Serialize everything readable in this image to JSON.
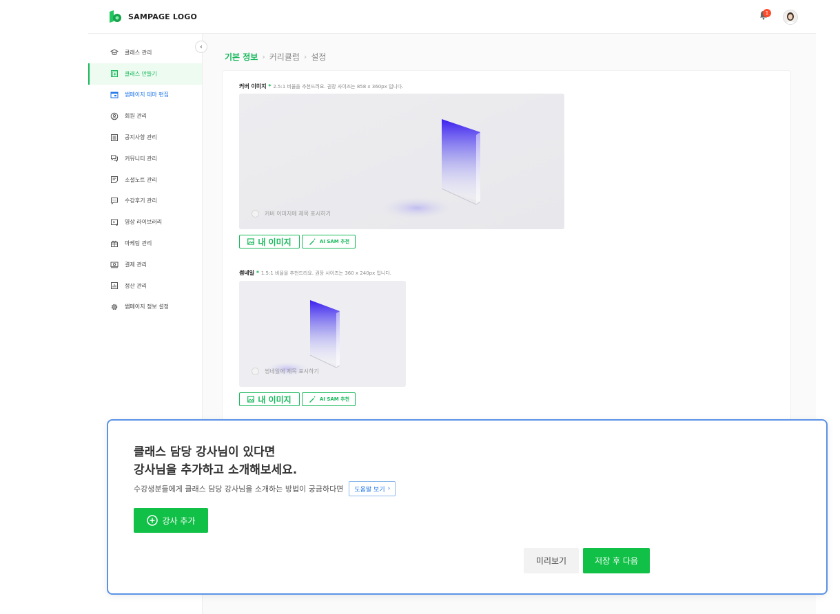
{
  "header": {
    "logo_text": "SAMPAGE LOGO",
    "notification_count": "1"
  },
  "sidebar": {
    "items": [
      {
        "label": "클래스 관리",
        "icon": "graduation-cap-icon"
      },
      {
        "label": "클래스 만들기",
        "icon": "add-box-icon"
      },
      {
        "label": "쌤페이지 테마 편집",
        "icon": "window-theme-icon"
      },
      {
        "label": "회원 관리",
        "icon": "user-circle-icon"
      },
      {
        "label": "공지사항 관리",
        "icon": "notice-list-icon"
      },
      {
        "label": "커뮤니티 관리",
        "icon": "chat-bubbles-icon"
      },
      {
        "label": "소셜노트 관리",
        "icon": "note-icon"
      },
      {
        "label": "수강후기 관리",
        "icon": "comment-icon"
      },
      {
        "label": "영상 라이브러리",
        "icon": "video-library-icon"
      },
      {
        "label": "마케팅 관리",
        "icon": "gift-icon"
      },
      {
        "label": "결제 관리",
        "icon": "payment-icon"
      },
      {
        "label": "정산 관리",
        "icon": "chart-icon"
      },
      {
        "label": "쌤페이지 정보 설정",
        "icon": "gear-icon"
      }
    ]
  },
  "breadcrumb": {
    "current": "기본 정보",
    "step2": "커리큘럼",
    "step3": "설정"
  },
  "cover": {
    "label": "커버 이미지",
    "required": "*",
    "hint": "2.5:1 비율을 추천드려요. 권장 사이즈는 858 x 360px 입니다.",
    "show_title_label": "커버 이미지에 제목 표시하기",
    "my_image_label": "내 이미지",
    "ai_label": "AI SAM 추천"
  },
  "thumbnail": {
    "label": "썸네일",
    "required": "*",
    "hint": "1.5:1 비율을 추천드리요. 권장 사이즈는 360 x 240px 입니다.",
    "show_title_label": "썸네일에 제목 표시하기",
    "my_image_label": "내 이미지",
    "ai_label": "AI SAM 추천"
  },
  "modal": {
    "title_line1": "클래스 담당 강사님이 있다면",
    "title_line2": "강사님을 추가하고 소개해보세요.",
    "description": "수강생분들에게 클래스 담당 강사님을 소개하는 방법이 궁금하다면",
    "help_label": "도움말 보기",
    "add_instructor_label": "강사 추가",
    "preview_label": "미리보기",
    "save_next_label": "저장 후 다음"
  },
  "colors": {
    "brand_green": "#16b85a",
    "button_green": "#11c047",
    "highlight_blue": "#5a92e6",
    "link_blue": "#1a73e8",
    "badge_red": "#ff4b2b"
  }
}
